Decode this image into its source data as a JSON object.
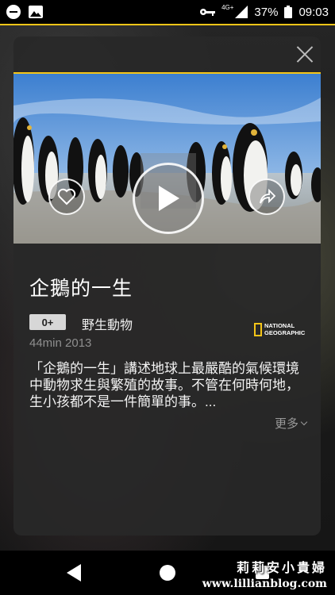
{
  "status_bar": {
    "network": "4G+",
    "battery": "37%",
    "time": "09:03"
  },
  "detail_card": {
    "title": "企鵝的一生",
    "rating": "0+",
    "genre": "野生動物",
    "meta": "44min  2013",
    "channel_logo_line1": "NATIONAL",
    "channel_logo_line2": "GEOGRAPHIC",
    "description": "「企鵝的一生」講述地球上最嚴酷的氣候環境中動物求生與繁殖的故事。不管在何時何地，生小孩都不是一件簡單的事。...",
    "more_label": "更多"
  },
  "watermark": {
    "name": "莉莉安小貴婦",
    "url": "www.lillianblog.com"
  },
  "colors": {
    "accent": "#f5c518",
    "card_bg": "#282828"
  }
}
